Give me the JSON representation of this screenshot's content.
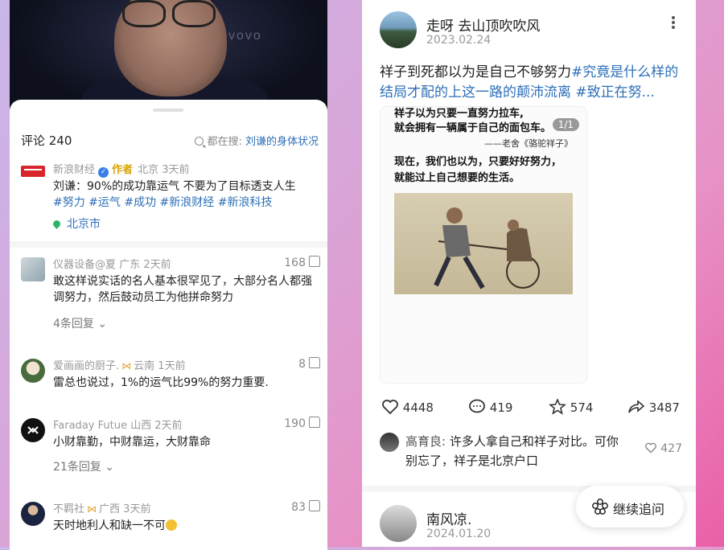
{
  "video": {
    "brand": "vovo"
  },
  "comments_panel": {
    "title": "评论 240",
    "search_prefix": "都在搜: ",
    "search_query": "刘谦的身体状况"
  },
  "post": {
    "author": "新浪财经",
    "author_tag": "作者",
    "region": "北京",
    "time": "3天前",
    "text": "刘谦：90%的成功靠运气 不要为了目标透支人生",
    "hashtags": "#努力 #运气 #成功 #新浪财经 #新浪科技",
    "location": "北京市"
  },
  "comments": [
    {
      "name": "仪器设备@夏",
      "region": "广东",
      "time": "2天前",
      "likes": "168",
      "text": "敢这样说实话的名人基本很罕见了，大部分名人都强调努力，然后鼓动员工为他拼命努力",
      "replies": "4条回复"
    },
    {
      "name": "爱画画的厨子.",
      "region": "云南",
      "time": "1天前",
      "likes": "8",
      "text": "雷总也说过，1%的运气比99%的努力重要."
    },
    {
      "name": "Faraday Futue",
      "region": "山西",
      "time": "2天前",
      "likes": "190",
      "text": "小财靠勤，中财靠运，大财靠命",
      "replies": "21条回复"
    },
    {
      "name": "不羁社",
      "region": "广西",
      "time": "3天前",
      "likes": "83",
      "text": "天时地利人和缺一不可"
    }
  ],
  "right_post": {
    "author": "走呀 去山顶吹吹风",
    "date": "2023.02.24",
    "text_plain": "祥子到死都以为是自己不够努力",
    "text_tags": "#究竟是什么样的结局才配的上这一路的颠沛流离 #致正在努...",
    "image": {
      "line1": "祥子以为只要一直努力拉车,",
      "line2": "就会拥有一辆属于自己的面包车。",
      "credit": "——老舍《骆驼祥子》",
      "line3": "现在，我们也以为，只要好好努力，",
      "line4": "就能过上自己想要的生活。",
      "counter": "1/1"
    },
    "actions": {
      "likes": "4448",
      "comments": "419",
      "favorites": "574",
      "shares": "3487"
    },
    "hot_comment": {
      "name": "高育良:",
      "text": "许多人拿自己和祥子对比。可你别忘了，祥子是北京户口",
      "likes": "427"
    },
    "next_post": {
      "author": "南风凉.",
      "date": "2024.01.20"
    }
  },
  "follow_button": {
    "label": "继续追问"
  }
}
